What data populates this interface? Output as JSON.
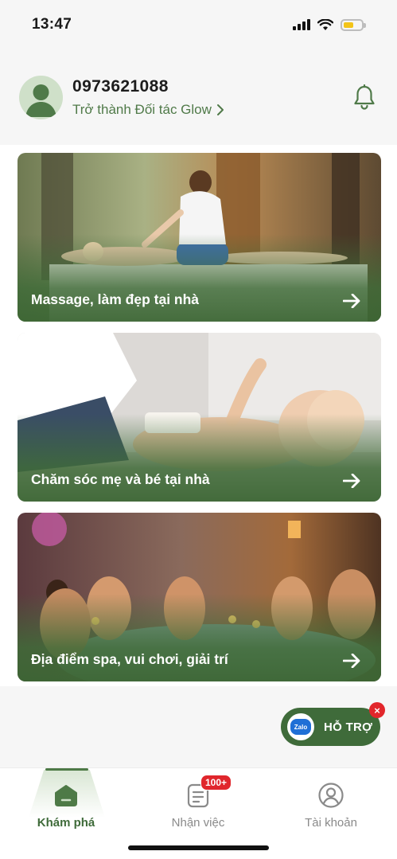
{
  "status_bar": {
    "time": "13:47"
  },
  "header": {
    "phone": "0973621088",
    "partner_link": "Trở thành Đối tác Glow"
  },
  "cards": [
    {
      "label": "Massage, làm đẹp tại nhà"
    },
    {
      "label": "Chăm sóc mẹ và bé tại nhà"
    },
    {
      "label": "Địa điểm spa, vui chơi, giải trí"
    }
  ],
  "support": {
    "label": "HỖ TRỢ",
    "zalo_text": "Zalo",
    "close": "×"
  },
  "bottom_nav": {
    "items": [
      {
        "label": "Khám phá",
        "active": true
      },
      {
        "label": "Nhận việc",
        "badge": "100+"
      },
      {
        "label": "Tài khoản"
      }
    ]
  },
  "colors": {
    "brand_green": "#3f6b3a",
    "accent_green": "#507a49",
    "badge_red": "#e0262c",
    "battery_yellow": "#f3c419"
  },
  "icons": [
    "signal-icon",
    "wifi-icon",
    "battery-icon",
    "user-avatar-icon",
    "chevron-right-icon",
    "bell-icon",
    "arrow-right-icon",
    "zalo-icon",
    "close-icon",
    "home-icon",
    "clipboard-icon",
    "account-circle-icon"
  ]
}
